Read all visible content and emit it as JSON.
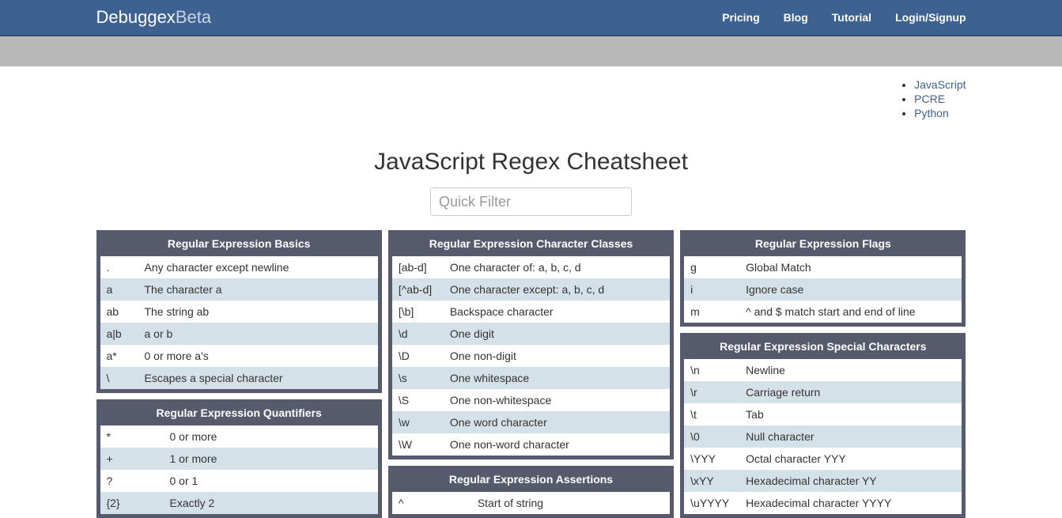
{
  "brand": {
    "name": "Debuggex",
    "suffix": "Beta"
  },
  "nav": {
    "pricing": "Pricing",
    "blog": "Blog",
    "tutorial": "Tutorial",
    "login": "Login/Signup"
  },
  "langs": {
    "javascript": "JavaScript",
    "pcre": "PCRE",
    "python": "Python"
  },
  "page_title": "JavaScript Regex Cheatsheet",
  "filter": {
    "placeholder": "Quick Filter"
  },
  "cards": {
    "basics": {
      "title": "Regular Expression Basics",
      "rows": [
        {
          "k": ".",
          "v": "Any character except newline"
        },
        {
          "k": "a",
          "v": "The character a"
        },
        {
          "k": "ab",
          "v": "The string ab"
        },
        {
          "k": "a|b",
          "v": "a or b"
        },
        {
          "k": "a*",
          "v": "0 or more a's"
        },
        {
          "k": "\\",
          "v": "Escapes a special character"
        }
      ]
    },
    "quantifiers": {
      "title": "Regular Expression Quantifiers",
      "rows": [
        {
          "k": "*",
          "v": "0 or more"
        },
        {
          "k": "+",
          "v": "1 or more"
        },
        {
          "k": "?",
          "v": "0 or 1"
        },
        {
          "k": "{2}",
          "v": "Exactly 2"
        }
      ]
    },
    "charclasses": {
      "title": "Regular Expression Character Classes",
      "rows": [
        {
          "k": "[ab-d]",
          "v": "One character of: a, b, c, d"
        },
        {
          "k": "[^ab-d]",
          "v": "One character except: a, b, c, d"
        },
        {
          "k": "[\\b]",
          "v": "Backspace character"
        },
        {
          "k": "\\d",
          "v": "One digit"
        },
        {
          "k": "\\D",
          "v": "One non-digit"
        },
        {
          "k": "\\s",
          "v": "One whitespace"
        },
        {
          "k": "\\S",
          "v": "One non-whitespace"
        },
        {
          "k": "\\w",
          "v": "One word character"
        },
        {
          "k": "\\W",
          "v": "One non-word character"
        }
      ]
    },
    "assertions": {
      "title": "Regular Expression Assertions",
      "rows": [
        {
          "k": "^",
          "v": "Start of string"
        }
      ]
    },
    "flags": {
      "title": "Regular Expression Flags",
      "rows": [
        {
          "k": "g",
          "v": "Global Match"
        },
        {
          "k": "i",
          "v": "Ignore case"
        },
        {
          "k": "m",
          "v": "^ and $ match start and end of line"
        }
      ]
    },
    "special": {
      "title": "Regular Expression Special Characters",
      "rows": [
        {
          "k": "\\n",
          "v": "Newline"
        },
        {
          "k": "\\r",
          "v": "Carriage return"
        },
        {
          "k": "\\t",
          "v": "Tab"
        },
        {
          "k": "\\0",
          "v": "Null character"
        },
        {
          "k": "\\YYY",
          "v": "Octal character YYY"
        },
        {
          "k": "\\xYY",
          "v": "Hexadecimal character YY"
        },
        {
          "k": "\\uYYYY",
          "v": "Hexadecimal character YYYY"
        }
      ]
    }
  }
}
